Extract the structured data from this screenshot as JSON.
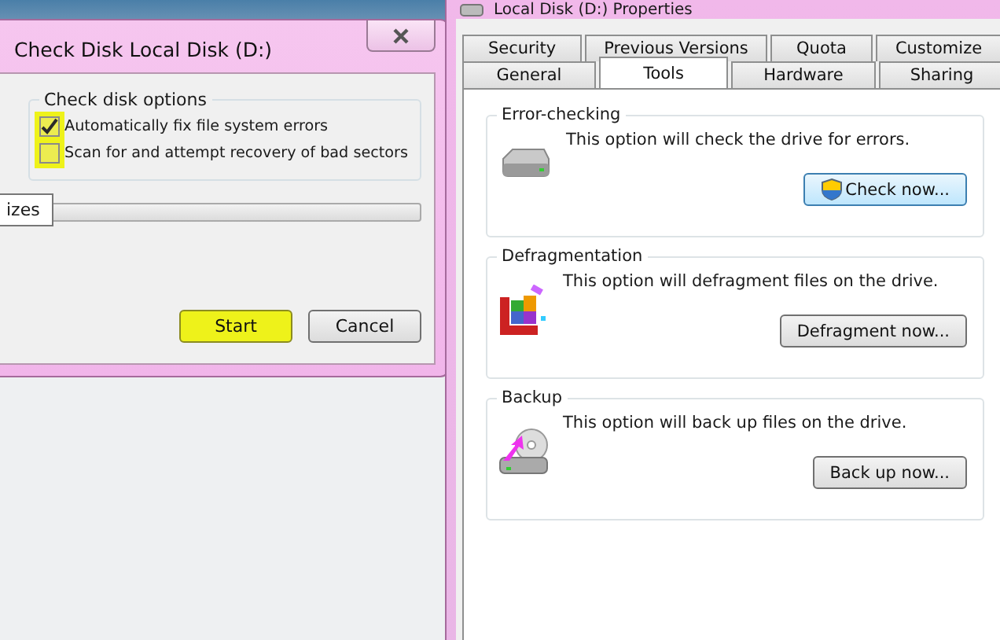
{
  "check_disk_dialog": {
    "title": "Check Disk Local Disk (D:)",
    "group_title": "Check disk options",
    "options": [
      {
        "label": "Automatically fix file system errors",
        "checked": true,
        "highlighted": true
      },
      {
        "label": "Scan for and attempt recovery of bad sectors",
        "checked": false,
        "highlighted": true
      }
    ],
    "tooltip": "izes",
    "progress": {
      "level": 0
    },
    "buttons": [
      {
        "label": "Start",
        "highlighted": true
      },
      {
        "label": "Cancel",
        "highlighted": false
      }
    ]
  },
  "properties_window": {
    "title": "Local Disk (D:) Properties",
    "tab_rows": [
      [
        {
          "label": "Security",
          "selected": false
        },
        {
          "label": "Previous Versions",
          "selected": false
        },
        {
          "label": "Quota",
          "selected": false
        },
        {
          "label": "Customize",
          "selected": false
        }
      ],
      [
        {
          "label": "General",
          "selected": false
        },
        {
          "label": "Tools",
          "selected": true
        },
        {
          "label": "Hardware",
          "selected": false
        },
        {
          "label": "Sharing",
          "selected": false
        }
      ]
    ],
    "sections": [
      {
        "kind": "check",
        "title": "Error-checking",
        "text": "This option will check the drive for errors.",
        "button": "Check now..."
      },
      {
        "kind": "defrag",
        "title": "Defragmentation",
        "text": "This option will defragment files on the drive.",
        "button": "Defragment now..."
      },
      {
        "kind": "backup",
        "title": "Backup",
        "text": "This option will back up files on the drive.",
        "button": "Back up now..."
      }
    ]
  }
}
